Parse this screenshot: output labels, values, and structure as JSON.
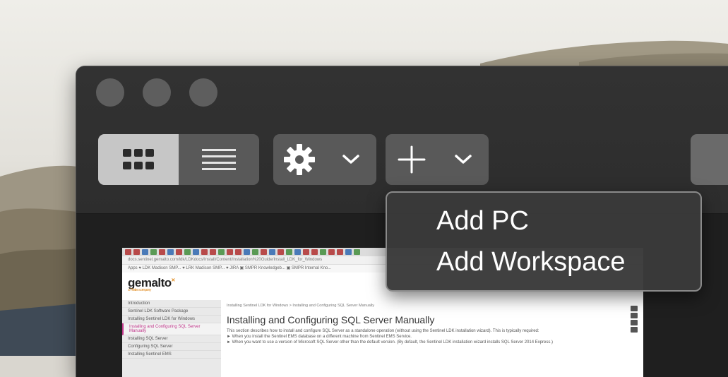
{
  "window": {
    "traffic_lights": [
      "close",
      "minimize",
      "zoom"
    ]
  },
  "toolbar": {
    "view_toggle": {
      "selected": "grid",
      "options": [
        "grid-icon",
        "list-icon"
      ]
    },
    "settings_button": {
      "icon": "gear-icon",
      "chevron": "chevron-down-icon"
    },
    "add_button": {
      "icon": "plus-icon",
      "chevron": "chevron-down-icon"
    }
  },
  "add_menu": {
    "items": [
      {
        "label": "Add PC"
      },
      {
        "label": "Add Workspace"
      }
    ]
  },
  "thumbnail": {
    "address": "docs.sentinel.gemalto.com/ldk/LDKdocs/Install/Content/Installation%20Guide/Install_LDK_for_Windows",
    "bookmarks": "Apps   ♥ LDK Madison SMP...   ♥ LRK Madison SMP...   ♥ JIRA   ▣ SMPR Knowledgeb...   ▣ SMPR Internal Kno...",
    "logo": "gemalto",
    "logo_tagline": "a Thales company",
    "sidebar": [
      "Introduction",
      "Sentinel LDK Software Package",
      "Installing Sentinel LDK for Windows",
      "Installing and Configuring SQL Server Manually",
      "Installing SQL Server",
      "Configuring SQL Server",
      "Installing Sentinel EMS"
    ],
    "breadcrumb": "Installing Sentinel LDK for Windows > Installing and Configuring SQL Server Manually",
    "heading": "Installing and Configuring SQL Server Manually",
    "paragraphs": [
      "This section describes how to install and configure SQL Server as a standalone operation (without using the Sentinel LDK installation wizard). This is typically required:",
      "►  When you install the Sentinel EMS database on a different machine from Sentinel EMS Service.",
      "►  When you want to use a version of Microsoft SQL Server other than the default version. (By default, the Sentinel LDK installation wizard installs SQL Server 2014 Express.)"
    ]
  }
}
